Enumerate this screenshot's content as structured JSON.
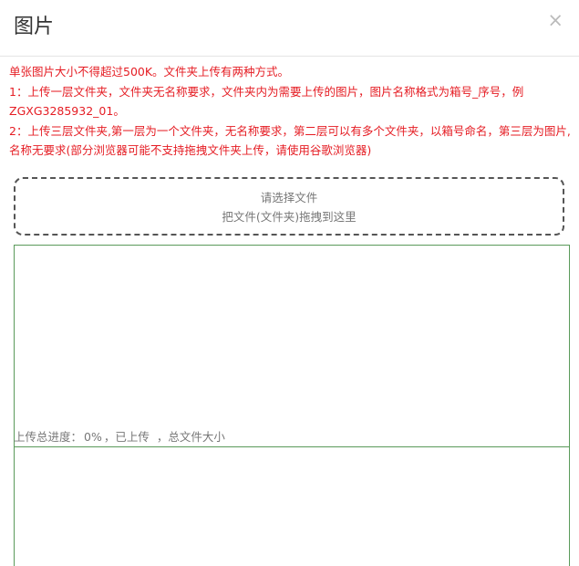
{
  "modal": {
    "title": "图片",
    "close_symbol": "×"
  },
  "instructions": {
    "line1": "单张图片大小不得超过500K。文件夹上传有两种方式。",
    "line2": "1：上传一层文件夹，文件夹无名称要求，文件夹内为需要上传的图片，图片名称格式为箱号_序号，例ZGXG3285932_01。",
    "line3": "2：上传三层文件夹,第一层为一个文件夹，无名称要求，第二层可以有多个文件夹，以箱号命名，第三层为图片,名称无要求(部分浏览器可能不支持拖拽文件夹上传，请使用谷歌浏览器)"
  },
  "dropzone": {
    "select_label": "请选择文件",
    "drag_label": "把文件(文件夹)拖拽到这里"
  },
  "progress": {
    "label": "上传总进度：",
    "percent": "0%",
    "uploaded_label": "，已上传",
    "uploaded_value": "",
    "total_label": "，总文件大小",
    "total_value": ""
  },
  "colors": {
    "instruction_red": "#e51c23",
    "list_border_green": "#5a9a5a"
  }
}
